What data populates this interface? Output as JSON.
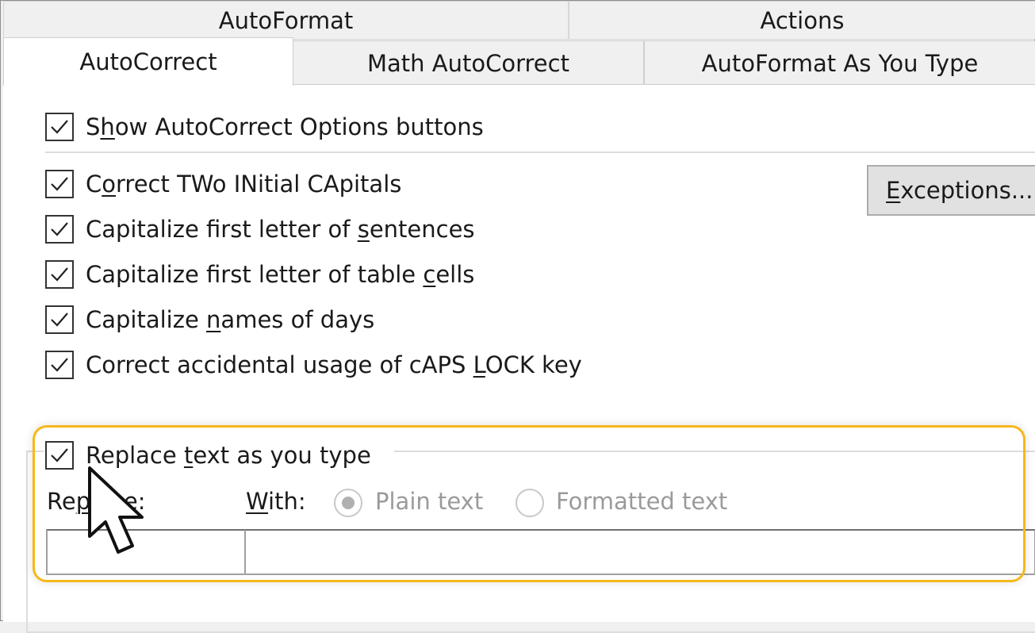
{
  "tabs": {
    "top_row": [
      "AutoFormat",
      "Actions"
    ],
    "bottom_row": [
      "AutoCorrect",
      "Math AutoCorrect",
      "AutoFormat As You Type"
    ],
    "active": "AutoCorrect"
  },
  "options": {
    "show_buttons": {
      "pre": "S",
      "u": "h",
      "post": "ow AutoCorrect Options buttons",
      "checked": true
    },
    "correct_two_initial": {
      "pre": "C",
      "u": "o",
      "post": "rrect TWo INitial CApitals",
      "checked": true
    },
    "capitalize_sentences": {
      "pre": "Capitalize first letter of ",
      "u": "s",
      "post": "entences",
      "checked": true
    },
    "capitalize_table_cells": {
      "pre": "Capitalize first letter of table ",
      "u": "c",
      "post": "ells",
      "checked": true
    },
    "capitalize_days": {
      "pre": "Capitalize ",
      "u": "n",
      "post": "ames of days",
      "checked": true
    },
    "caps_lock": {
      "pre": "Correct accidental usage of cAPS ",
      "u": "L",
      "post": "OCK key",
      "checked": true
    }
  },
  "exceptions_button": {
    "u": "E",
    "post": "xceptions..."
  },
  "replace_group": {
    "checkbox": {
      "pre": "Replace ",
      "u": "t",
      "post": "ext as you type",
      "checked": true
    },
    "replace_label": {
      "pre": "Re",
      "u": "p",
      "post": "lace:"
    },
    "with_label": {
      "u": "W",
      "post": "ith:"
    },
    "radio_plain": {
      "label": "Plain text",
      "selected": true
    },
    "radio_formatted": {
      "label": "Formatted text",
      "selected": false
    },
    "replace_value": "",
    "with_value": ""
  },
  "colors": {
    "highlight": "#f6b81a",
    "panel": "#ffffff",
    "chrome": "#f0f0f0"
  }
}
